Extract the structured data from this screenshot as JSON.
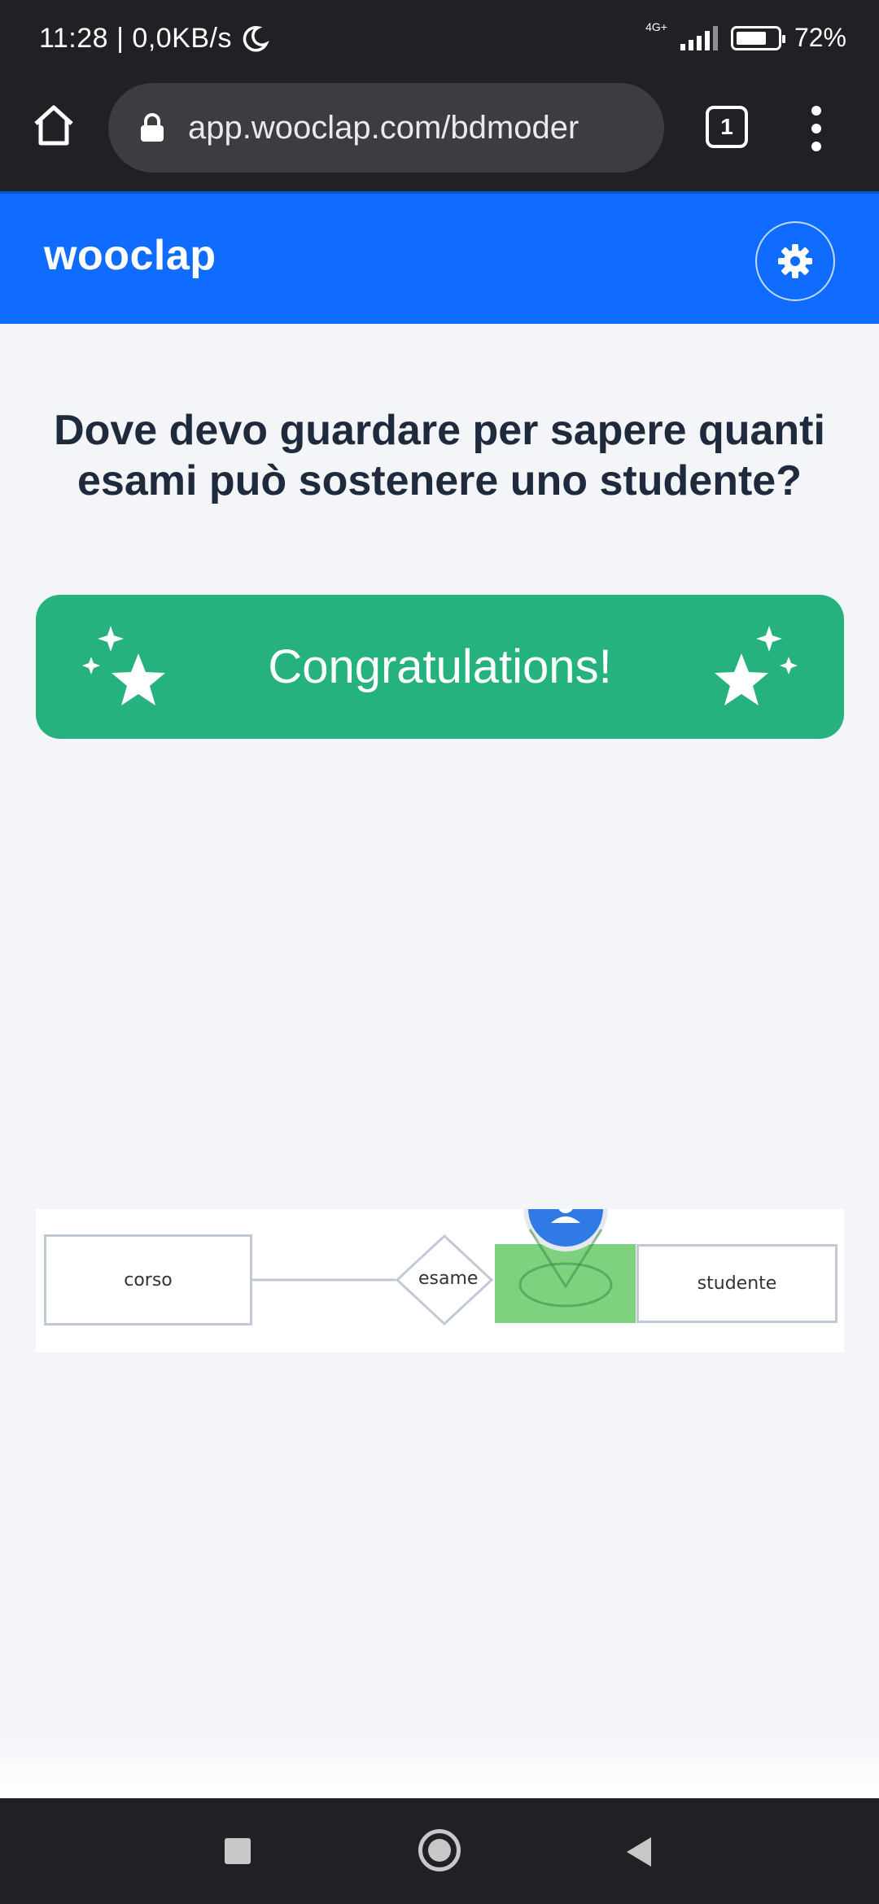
{
  "status_bar": {
    "time": "11:28",
    "separator": "|",
    "speed": "0,0KB/s",
    "network": "4G+",
    "battery": "72%",
    "battery_fill": 0.72,
    "icons": [
      "moon-icon",
      "signal-icon",
      "battery-icon"
    ]
  },
  "browser": {
    "url": "app.wooclap.com/bdmoder",
    "tab_count": "1",
    "icons": [
      "home-icon",
      "lock-icon",
      "tabs-icon",
      "more-menu-icon"
    ]
  },
  "app": {
    "logo": "wooclap",
    "brand_color": "#0f6cff",
    "settings_icon": "gear-icon"
  },
  "question": {
    "text": "Dove devo guardare per sapere quanti esami può sostenere uno studente?"
  },
  "result": {
    "label": "Congratulations!",
    "color": "#26b27f",
    "icons": [
      "sparkle-star-icon",
      "sparkle-star-icon"
    ]
  },
  "diagram": {
    "entities": [
      "corso",
      "studente"
    ],
    "relationship": "esame",
    "highlight_color": "#7ed27e",
    "marker_icon": "location-pin-icon"
  },
  "nav_bar": {
    "icons": [
      "recents-square-icon",
      "home-circle-icon",
      "back-triangle-icon"
    ]
  }
}
